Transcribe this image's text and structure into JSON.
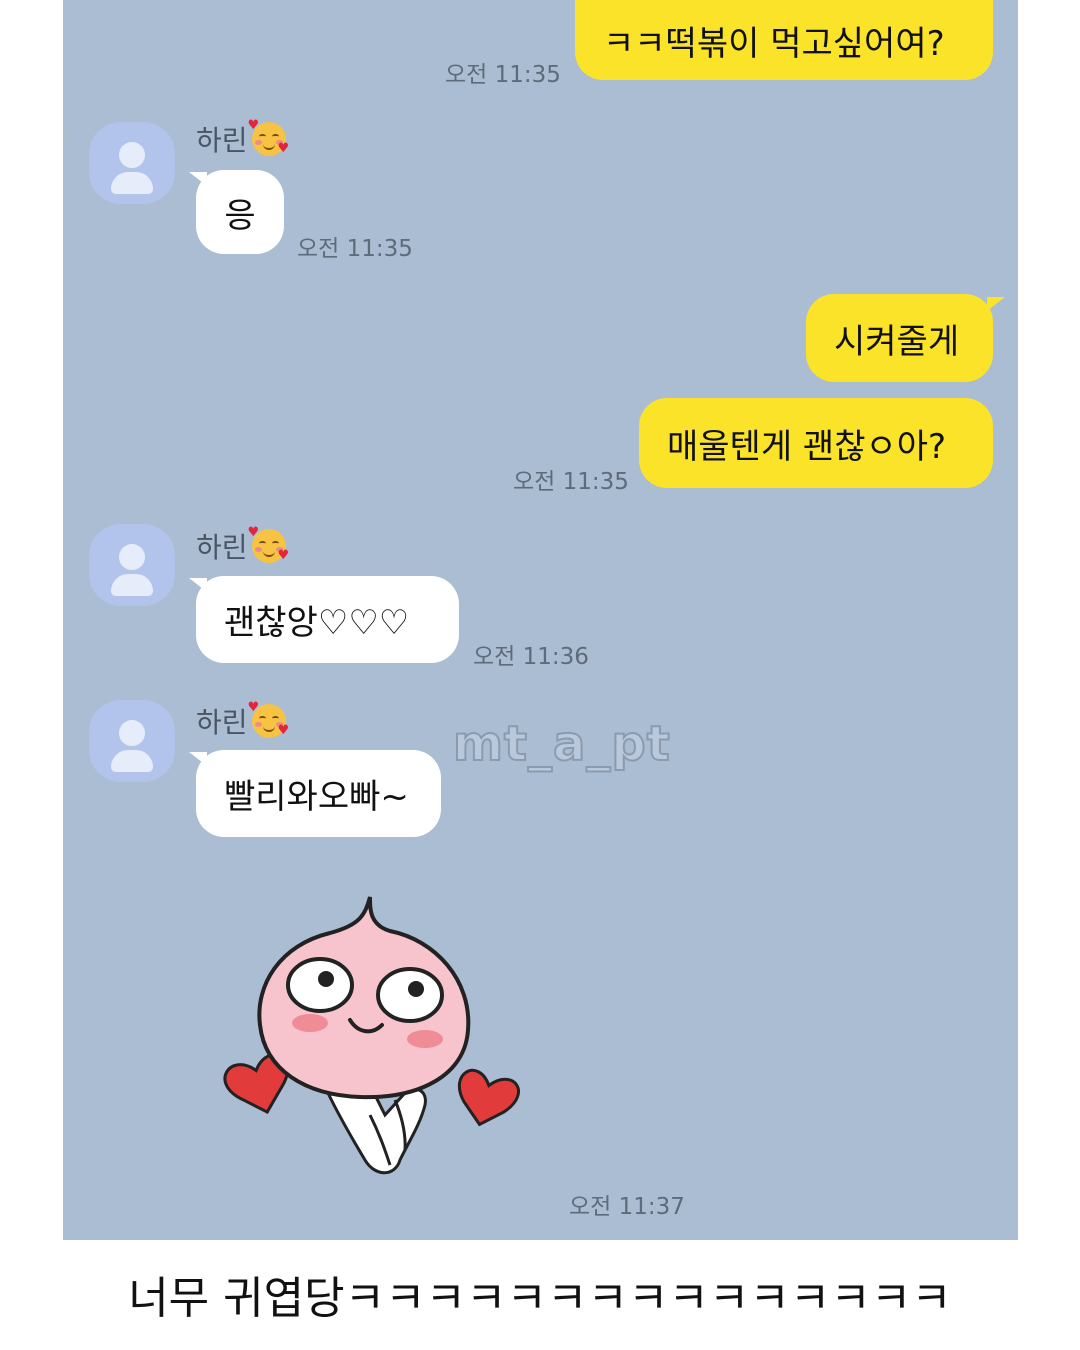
{
  "messages": {
    "m1": {
      "text": "ㅋㅋ떡볶이 먹고싶어여?",
      "time": "오전 11:35"
    },
    "m2": {
      "sender": "하린",
      "text": "응",
      "time": "오전 11:35"
    },
    "m3": {
      "text": "시켜줄게"
    },
    "m4": {
      "text": "매울텐게 괜찮ㅇ아?",
      "time": "오전 11:35"
    },
    "m5": {
      "sender": "하린",
      "text": "괜찮앙♡♡♡",
      "time": "오전 11:36"
    },
    "m6": {
      "sender": "하린",
      "text": "빨리와오빠~"
    },
    "m7": {
      "time": "오전 11:37"
    }
  },
  "watermark": "mt_a_pt",
  "caption": "너무 귀엽당ㅋㅋㅋㅋㅋㅋㅋㅋㅋㅋㅋㅋㅋㅋㅋ",
  "colors": {
    "chat_background": "#abbdd3",
    "my_bubble": "#fbe32a",
    "other_bubble": "#ffffff"
  },
  "icons": {
    "avatar": "default-profile-icon",
    "name_emoji": "smiling-face-with-hearts-emoji",
    "sticker": "apeach-peach-character-sticker"
  }
}
